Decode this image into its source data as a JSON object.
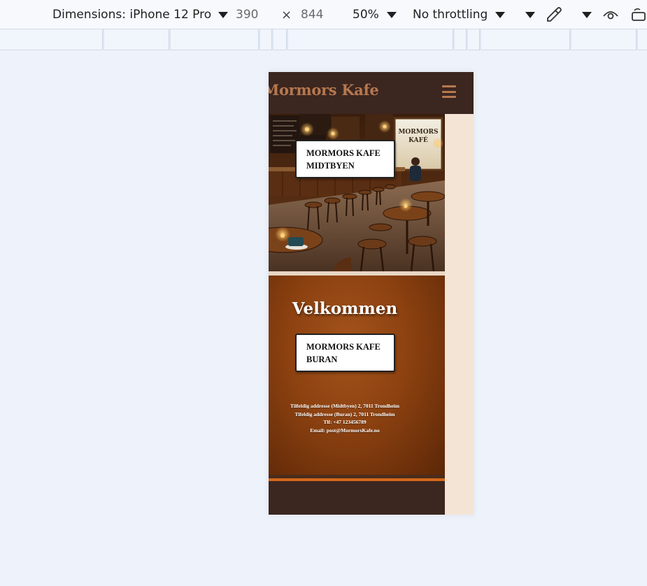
{
  "devtools": {
    "device_label": "Dimensions: iPhone 12 Pro",
    "width": "390",
    "times": "×",
    "height": "844",
    "zoom": "50%",
    "throttling": "No throttling",
    "icons": [
      "chevron-down-icon",
      "eyedropper-icon",
      "eye-icon",
      "rotate-icon"
    ]
  },
  "site": {
    "brand": "Mormors Kafe",
    "menu_icon": "hamburger-icon",
    "hero_sign": "MORMORS KAFÉ",
    "buttons": {
      "midtbyen": "MORMORS KAFE MIDTBYEN",
      "buran": "MORMORS KAFE BURAN"
    },
    "welcome_title": "Velkommen",
    "contact": [
      "Tilfeldig addresse (Midtbyen) 2, 7011 Trondheim",
      "Tifeldig addresse (Buran) 2, 7011 Trondheim",
      "Tlf: +47 123456789",
      "Email: post@MormorsKafe.no"
    ]
  },
  "colors": {
    "header_bg": "#3b2620",
    "brand": "#b6784e",
    "accent_orange": "#d4681a",
    "page_bg": "#eef2fa"
  }
}
